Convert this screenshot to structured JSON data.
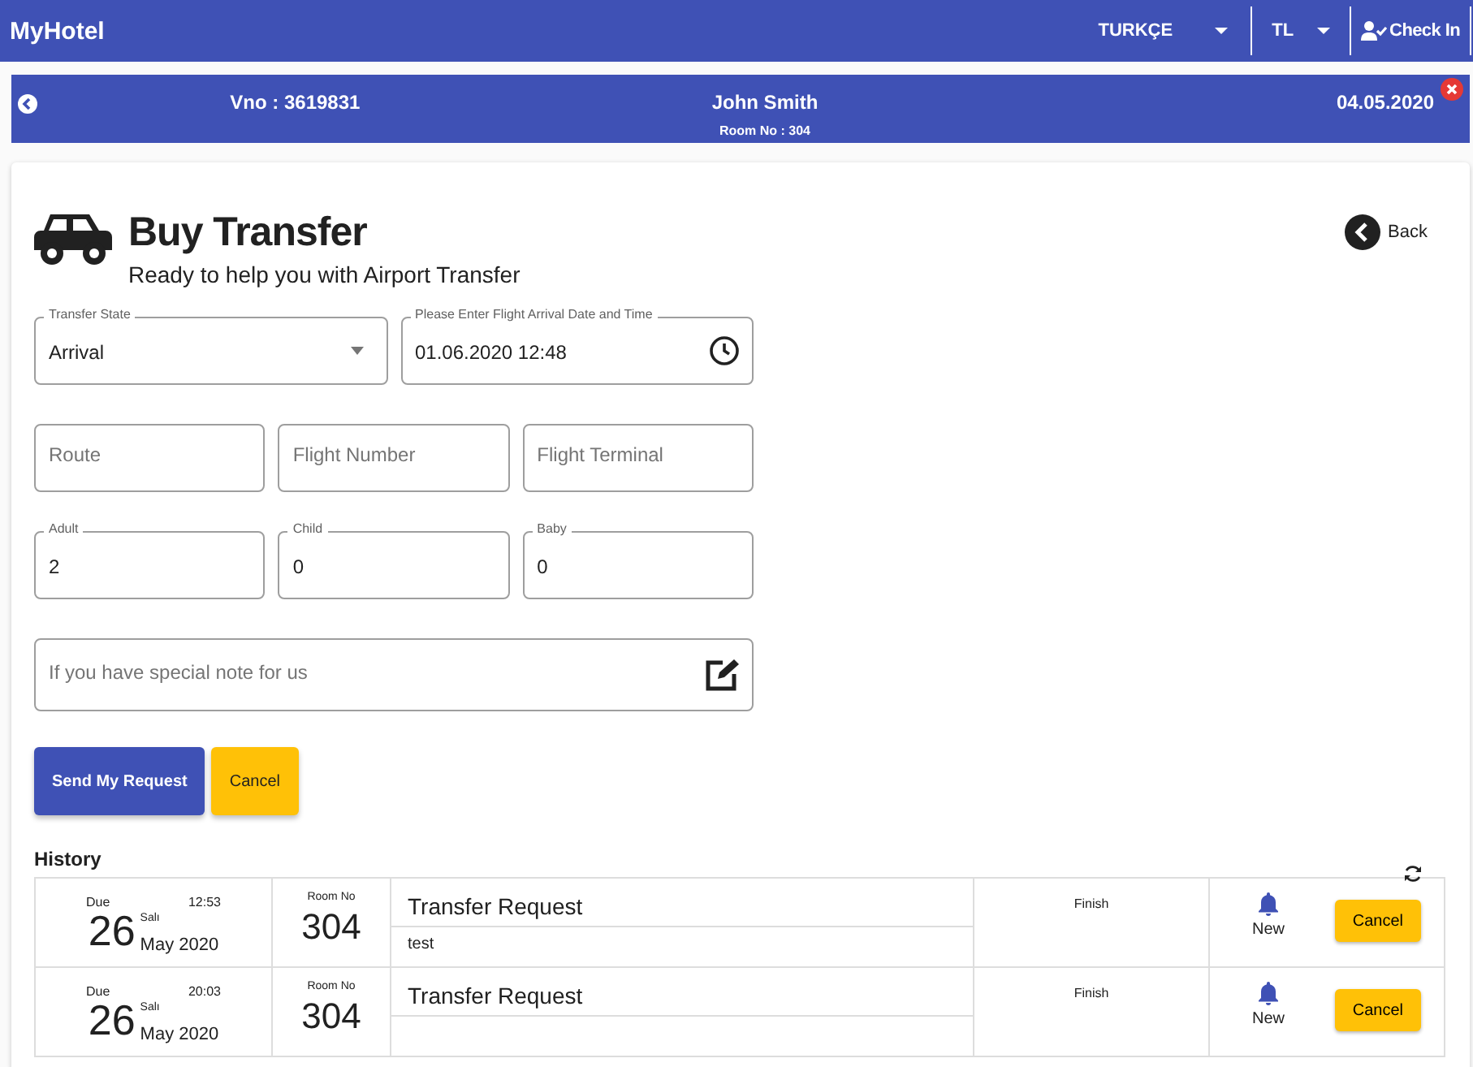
{
  "app_bar": {
    "title": "MyHotel",
    "language": "TURKÇE",
    "currency": "TL",
    "check_in": "Check In"
  },
  "guest_bar": {
    "voucher": "Vno : 3619831",
    "guest": "John Smith",
    "room": "Room No : 304",
    "date": "04.05.2020"
  },
  "header": {
    "title": "Buy Transfer",
    "subtitle": "Ready to help you with Airport Transfer",
    "back": "Back"
  },
  "fields": [
    {
      "kind": "select",
      "label": "Transfer State",
      "value": "Arrival"
    },
    {
      "kind": "datetime",
      "label": "Please Enter Flight Arrival Date and Time",
      "value": "01.06.2020 12:48"
    },
    {
      "kind": "text",
      "placeholder": "Route"
    },
    {
      "kind": "text",
      "placeholder": "Flight Number"
    },
    {
      "kind": "text",
      "placeholder": "Flight Terminal"
    },
    {
      "kind": "text",
      "label": "Adult",
      "value": "2"
    },
    {
      "kind": "text",
      "label": "Child",
      "value": "0"
    },
    {
      "kind": "text",
      "label": "Baby",
      "value": "0"
    },
    {
      "kind": "note",
      "placeholder": "If you have special note for us"
    }
  ],
  "buttons": [
    {
      "kind": "primary",
      "label": "Send My Request"
    },
    {
      "kind": "warning",
      "label": "Cancel"
    }
  ],
  "history": {
    "title": "History",
    "rows": [
      {
        "due": "Due",
        "time": "12:53",
        "day": "26",
        "weekday": "Salı",
        "month": "May 2020",
        "room_label": "Room No",
        "room": "304",
        "title": "Transfer Request",
        "note": "test",
        "status": "Finish",
        "state": "New",
        "action": "Cancel"
      },
      {
        "due": "Due",
        "time": "20:03",
        "day": "26",
        "weekday": "Salı",
        "month": "May 2020",
        "room_label": "Room No",
        "room": "304",
        "title": "Transfer Request",
        "status": "Finish",
        "state": "New",
        "action": "Cancel"
      }
    ]
  }
}
